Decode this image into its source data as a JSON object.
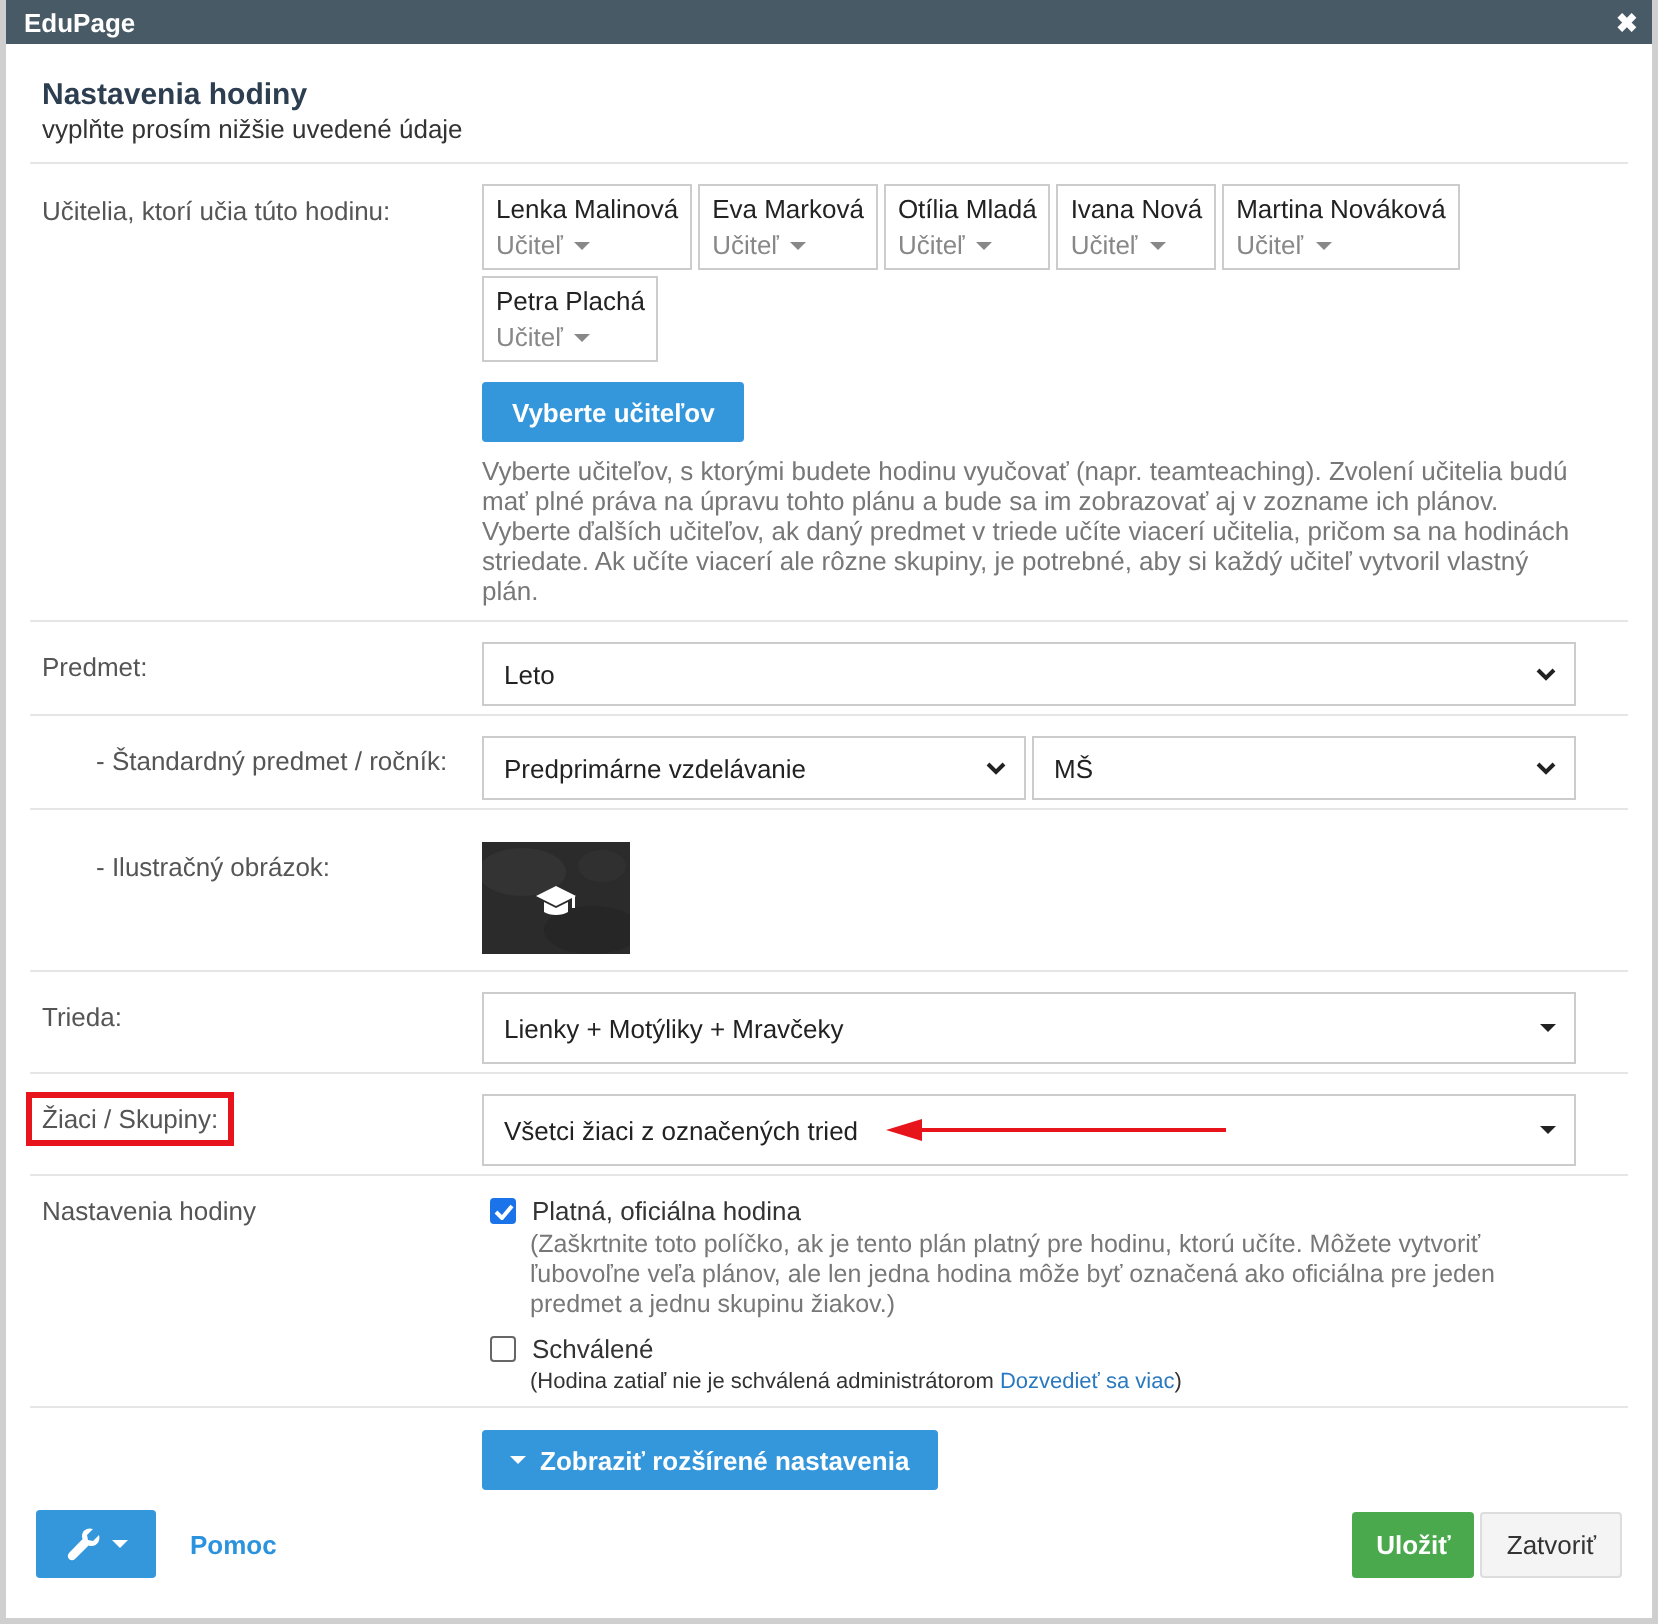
{
  "window": {
    "title": "EduPage",
    "close": "✖"
  },
  "header": {
    "title": "Nastavenia hodiny",
    "subtitle": "vyplňte prosím nižšie uvedené údaje"
  },
  "teachers": {
    "label": "Učitelia, ktorí učia túto hodinu:",
    "items": [
      {
        "name": "Lenka Malinová",
        "role": "Učiteľ"
      },
      {
        "name": "Eva Marková",
        "role": "Učiteľ"
      },
      {
        "name": "Otília Mladá",
        "role": "Učiteľ"
      },
      {
        "name": "Ivana Nová",
        "role": "Učiteľ"
      },
      {
        "name": "Martina Nováková",
        "role": "Učiteľ"
      },
      {
        "name": "Petra Plachá",
        "role": "Učiteľ"
      }
    ],
    "button": "Vyberte učiteľov",
    "help": "Vyberte učiteľov, s ktorými budete hodinu vyučovať (napr. teamteaching). Zvolení učitelia budú mať plné práva na úpravu tohto plánu a bude sa im zobrazovať aj v zozname ich plánov. Vyberte ďalších učiteľov, ak daný predmet v triede učíte viacerí učitelia, pričom sa na hodinách striedate. Ak učíte viacerí ale rôzne skupiny, je potrebné, aby si každý učiteľ vytvoril vlastný plán."
  },
  "rows": [
    {
      "kind": "select",
      "label": "Predmet:",
      "highlighted": false,
      "fields": [
        {
          "kind": "native",
          "value": "Leto"
        }
      ],
      "children": [
        {
          "kind": "select",
          "label": "- Štandardný predmet / ročník:",
          "highlighted": false,
          "fields": [
            {
              "kind": "native",
              "value": "Predprimárne vzdelávanie"
            },
            {
              "kind": "native",
              "value": "MŠ"
            }
          ]
        },
        {
          "label": "- Ilustračný obrázok:",
          "highlighted": false
        }
      ]
    },
    {
      "kind": "select",
      "label": "Trieda:",
      "highlighted": false,
      "fields": [
        {
          "kind": "dropdown",
          "value": "Lienky + Motýliky + Mravčeky"
        }
      ]
    },
    {
      "kind": "select",
      "label": "Žiaci / Skupiny:",
      "highlighted": true,
      "arrow": true,
      "fields": [
        {
          "kind": "dropdown",
          "value": "Všetci žiaci z označených tried"
        }
      ]
    }
  ],
  "settings": {
    "label": "Nastavenia hodiny",
    "options": [
      {
        "label": "Platná, oficiálna hodina",
        "checked": true,
        "note": "(Zaškrtnite toto políčko, ak je tento plán platný pre hodinu, ktorú učíte. Môžete vytvoriť ľubovoľne veľa plánov, ale len jedna hodina môže byť označená ako oficiálna pre jeden predmet a jednu skupinu žiakov.)"
      },
      {
        "label": "Schválené",
        "checked": false,
        "note": "(Hodina zatiaľ nie je schválená administrátorom",
        "link": "Dozvedieť sa viac",
        "note_end": ")"
      }
    ]
  },
  "advanced_button": "Zobraziť rozšírené nastavenia",
  "footer": {
    "help_link": "Pomoc",
    "save": "Uložiť",
    "close": "Zatvoriť"
  }
}
